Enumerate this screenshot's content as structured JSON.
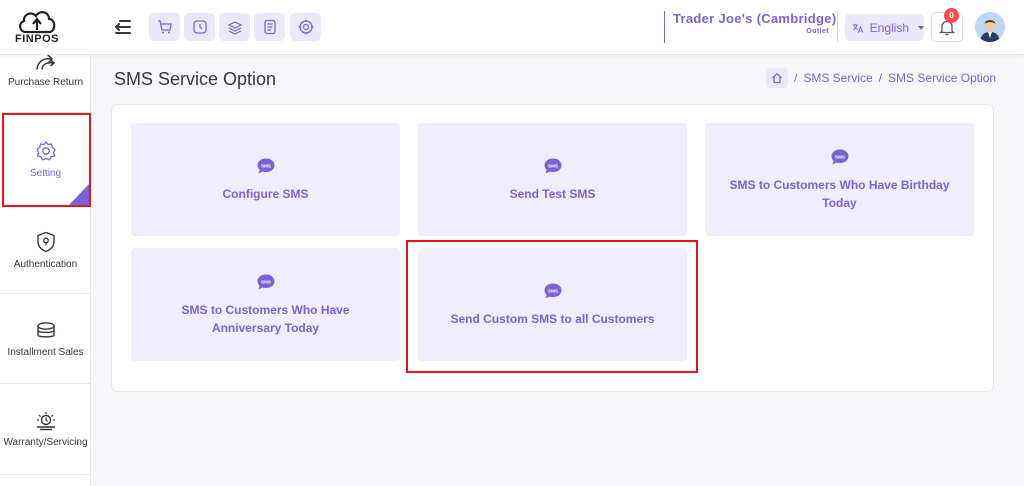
{
  "app": {
    "logo_text": "FINPOS"
  },
  "header": {
    "store_name": "Trader Joe's (Cambridge)",
    "store_type": "Outlet",
    "language": "English",
    "notification_count": "0",
    "quick_icons": [
      "cart-icon",
      "clock-icon",
      "stack-icon",
      "receipt-icon",
      "target-icon"
    ]
  },
  "sidebar": {
    "items": [
      {
        "label": "Purchase Return",
        "icon": "purchase-return-icon"
      },
      {
        "label": "Setting",
        "icon": "gear-icon",
        "active": true
      },
      {
        "label": "Authentication",
        "icon": "shield-icon"
      },
      {
        "label": "Installment Sales",
        "icon": "layers-icon"
      },
      {
        "label": "Warranty/Servicing",
        "icon": "servicing-icon"
      }
    ]
  },
  "page": {
    "title": "SMS Service Option",
    "breadcrumb": [
      "SMS Service",
      "SMS Service Option"
    ]
  },
  "cards": [
    {
      "label": "Configure SMS",
      "icon": "sms-icon"
    },
    {
      "label": "Send Test SMS",
      "icon": "sms-icon"
    },
    {
      "label": "SMS to Customers Who Have Birthday Today",
      "icon": "sms-icon"
    },
    {
      "label": "SMS to Customers Who Have Anniversary Today",
      "icon": "sms-icon"
    },
    {
      "label": "Send Custom SMS to all Customers",
      "icon": "sms-icon"
    }
  ],
  "colors": {
    "accent": "#7b63d6",
    "card_bg": "#f0edfc",
    "highlight": "#e5171c",
    "badge": "#ff4c51"
  }
}
